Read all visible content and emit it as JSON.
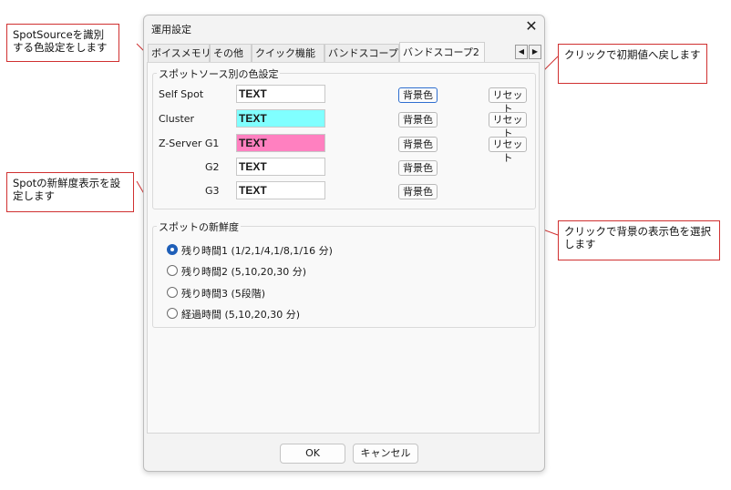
{
  "dialog": {
    "title": "運用設定"
  },
  "tabs": [
    "ボイスメモリ",
    "その他",
    "クイック機能",
    "バンドスコープ",
    "バンドスコープ2"
  ],
  "color_group": {
    "label": "スポットソース別の色設定",
    "rows": [
      {
        "label": "Self Spot",
        "text": "TEXT",
        "bg": "#ffffff",
        "button": "背景色",
        "reset": "リセット"
      },
      {
        "label": "Cluster",
        "text": "TEXT",
        "bg": "#80ffff",
        "button": "背景色",
        "reset": "リセット"
      },
      {
        "label": "Z-Server G1",
        "text": "TEXT",
        "bg": "#ff80c0",
        "button": "背景色",
        "reset": "リセット"
      },
      {
        "label": "G2",
        "text": "TEXT",
        "bg": "#ffffff",
        "button": "背景色"
      },
      {
        "label": "G3",
        "text": "TEXT",
        "bg": "#ffffff",
        "button": "背景色"
      }
    ]
  },
  "freshness_group": {
    "label": "スポットの新鮮度",
    "options": [
      {
        "label": "残り時間1 (1/2,1/4,1/8,1/16 分)",
        "checked": true
      },
      {
        "label": "残り時間2 (5,10,20,30 分)",
        "checked": false
      },
      {
        "label": "残り時間3 (5段階)",
        "checked": false
      },
      {
        "label": "経過時間 (5,10,20,30 分)",
        "checked": false
      }
    ]
  },
  "footer": {
    "ok": "OK",
    "cancel": "キャンセル"
  },
  "callouts": {
    "source": "SpotSourceを識別する色設定をします",
    "freshness": "Spotの新鮮度表示を設定します",
    "reset": "クリックで初期値へ戻します",
    "background": "クリックで背景の表示色を選択します"
  },
  "colors": {
    "accent": "#1f5fb8",
    "callout_border": "#d03030"
  }
}
